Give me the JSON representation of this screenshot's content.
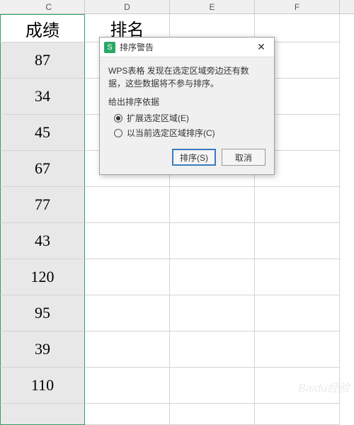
{
  "colLetters": {
    "c": "C",
    "d": "D",
    "e": "E",
    "f": "F"
  },
  "headers": {
    "c": "成绩",
    "d": "排名"
  },
  "values": [
    "87",
    "34",
    "45",
    "67",
    "77",
    "43",
    "120",
    "95",
    "39",
    "110"
  ],
  "dialog": {
    "iconLetter": "S",
    "title": "排序警告",
    "message": "WPS表格 发现在选定区域旁边还有数据，这些数据将不参与排序。",
    "label": "给出排序依据",
    "option1": "扩展选定区域(E)",
    "option2": "以当前选定区域排序(C)",
    "sortBtn": "排序(S)",
    "cancelBtn": "取消"
  },
  "watermark": "Baidu经验"
}
